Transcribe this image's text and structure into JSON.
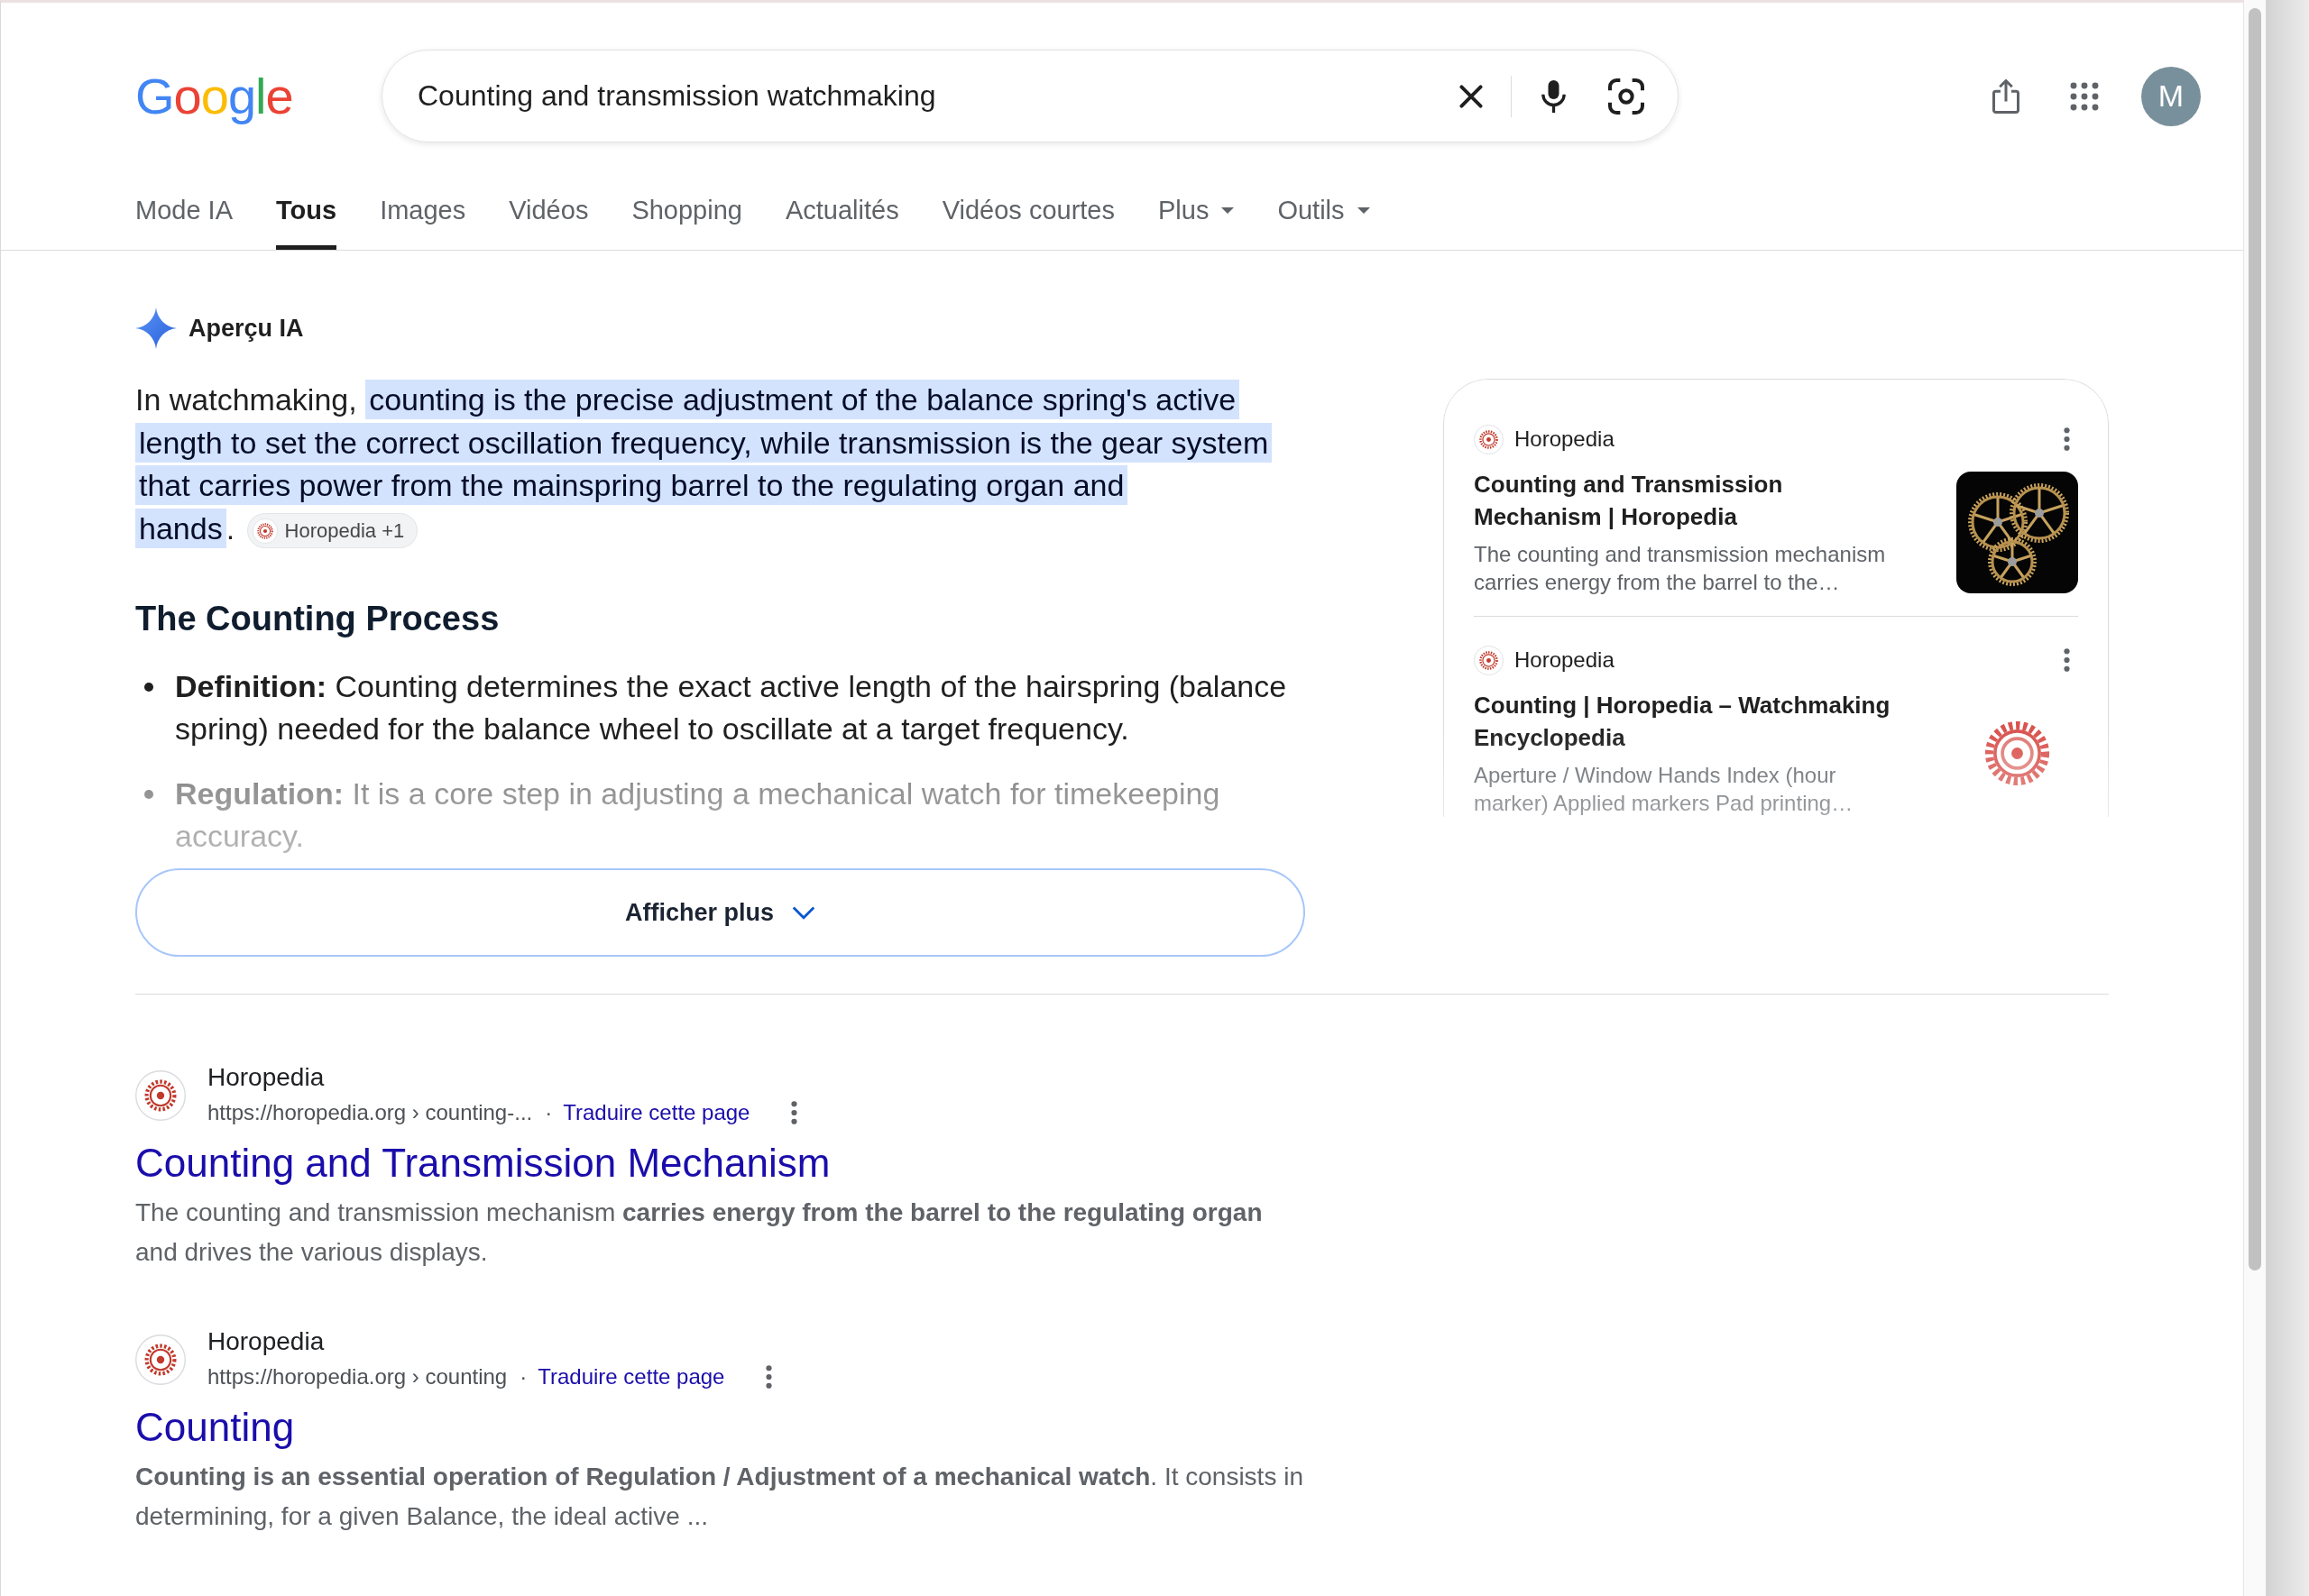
{
  "header": {
    "logo": "Google",
    "search": {
      "value": "Counting and transmission watchmaking"
    },
    "avatar_initial": "M"
  },
  "tabs": [
    {
      "label": "Mode IA",
      "selected": false,
      "has_menu": false
    },
    {
      "label": "Tous",
      "selected": true,
      "has_menu": false
    },
    {
      "label": "Images",
      "selected": false,
      "has_menu": false
    },
    {
      "label": "Vidéos",
      "selected": false,
      "has_menu": false
    },
    {
      "label": "Shopping",
      "selected": false,
      "has_menu": false
    },
    {
      "label": "Actualités",
      "selected": false,
      "has_menu": false
    },
    {
      "label": "Vidéos courtes",
      "selected": false,
      "has_menu": false
    },
    {
      "label": "Plus",
      "selected": false,
      "has_menu": true
    },
    {
      "label": "Outils",
      "selected": false,
      "has_menu": true
    }
  ],
  "ai_overview": {
    "title": "Aperçu IA",
    "expanded": false,
    "text_before": "In watchmaking,",
    "highlighted": "counting is the precise adjustment of the balance spring's active length to set the correct oscillation frequency, while transmission is the gear system that carries power from the mainspring barrel to the regulating organ and hands",
    "text_after": ".",
    "citation": "Horopedia +1",
    "heading": "The Counting Process",
    "bullets": [
      "**Definition:** Counting determines the exact active length of the hairspring (balance spring) needed for the balance wheel to oscillate at a target frequency.",
      "**Regulation:** It is a core step in adjusting a mechanical watch for timekeeping accuracy."
    ],
    "show_more": "Afficher plus",
    "sources": [
      {
        "site": "Horopedia",
        "title": "Counting and Transmission Mechanism | Horopedia",
        "snippet": "The counting and transmission mechanism carries energy from the barrel to the…",
        "kind": "photo"
      },
      {
        "site": "Horopedia",
        "title": "Counting | Horopedia – Watchmaking Encyclopedia",
        "snippet": "Aperture / Window Hands Index (hour marker) Applied markers Pad printing…",
        "kind": "logo"
      }
    ]
  },
  "results": [
    {
      "site": "Horopedia",
      "url": "https://horopedia.org › counting-...",
      "separator": "·",
      "translate": "Traduire cette page",
      "title": "Counting and Transmission Mechanism",
      "snippet": "The counting and transmission mechanism **carries energy from the barrel to the regulating organ** and drives the various displays."
    },
    {
      "site": "Horopedia",
      "url": "https://horopedia.org › counting",
      "separator": "·",
      "translate": "Traduire cette page",
      "title": "Counting",
      "snippet": "**Counting is an essential operation of Regulation / Adjustment of a mechanical watch**. It consists in determining, for a given Balance, the ideal active ..."
    }
  ]
}
